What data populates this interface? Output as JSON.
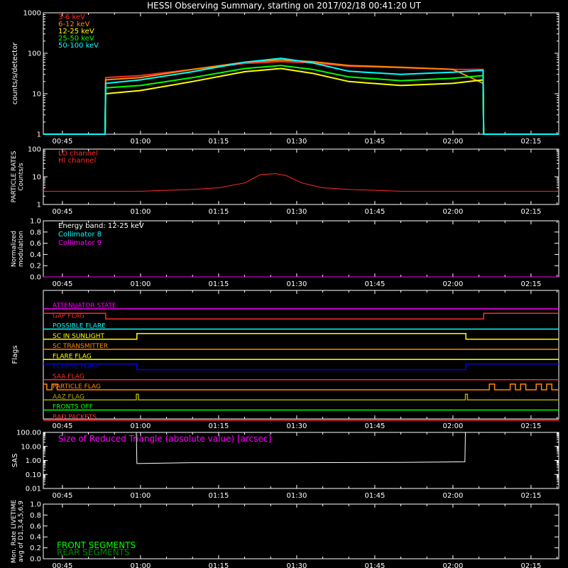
{
  "title": "HESSI Observing Summary, starting on 2017/02/18 00:41:20 UT",
  "time_ticks": [
    "00:45",
    "01:00",
    "01:15",
    "01:30",
    "01:45",
    "02:00",
    "02:15"
  ],
  "chart_data": [
    {
      "type": "line",
      "panel": "counts",
      "ylabel": "counts/s/detector",
      "yscale": "log",
      "ylim": [
        1,
        1000
      ],
      "yticks": [
        "1",
        "10",
        "100",
        "1000"
      ],
      "x_range_min": [
        41.33,
        140.33
      ],
      "series": [
        {
          "name": "3-6 keV",
          "color": "#ff2a2a",
          "points": [
            [
              41.33,
              1
            ],
            [
              53.2,
              1
            ],
            [
              53.3,
              25
            ],
            [
              60,
              28
            ],
            [
              70,
              40
            ],
            [
              80,
              56
            ],
            [
              87,
              62
            ],
            [
              93,
              58
            ],
            [
              100,
              48
            ],
            [
              110,
              44
            ],
            [
              120,
              40
            ],
            [
              125.8,
              40
            ],
            [
              125.9,
              1
            ],
            [
              140.33,
              1
            ]
          ]
        },
        {
          "name": "6-12 keV",
          "color": "#ff8800",
          "points": [
            [
              41.33,
              1
            ],
            [
              53.2,
              1
            ],
            [
              53.3,
              22
            ],
            [
              60,
              25
            ],
            [
              70,
              40
            ],
            [
              80,
              60
            ],
            [
              87,
              68
            ],
            [
              93,
              62
            ],
            [
              100,
              50
            ],
            [
              110,
              45
            ],
            [
              120,
              40
            ],
            [
              125.8,
              18
            ],
            [
              125.9,
              1
            ],
            [
              140.33,
              1
            ]
          ]
        },
        {
          "name": "12-25 keV",
          "color": "#ffff00",
          "points": [
            [
              41.33,
              1
            ],
            [
              53.2,
              1
            ],
            [
              53.3,
              10
            ],
            [
              60,
              12
            ],
            [
              70,
              20
            ],
            [
              80,
              35
            ],
            [
              87,
              42
            ],
            [
              93,
              32
            ],
            [
              100,
              20
            ],
            [
              110,
              16
            ],
            [
              120,
              18
            ],
            [
              125.8,
              22
            ],
            [
              125.9,
              1
            ],
            [
              140.33,
              1
            ]
          ]
        },
        {
          "name": "25-50 keV",
          "color": "#00ff00",
          "points": [
            [
              41.33,
              1
            ],
            [
              53.2,
              1
            ],
            [
              53.3,
              14
            ],
            [
              60,
              16
            ],
            [
              70,
              25
            ],
            [
              80,
              42
            ],
            [
              87,
              50
            ],
            [
              93,
              40
            ],
            [
              100,
              26
            ],
            [
              110,
              21
            ],
            [
              120,
              24
            ],
            [
              125.8,
              28
            ],
            [
              125.9,
              1
            ],
            [
              140.33,
              1
            ]
          ]
        },
        {
          "name": "50-100 keV",
          "color": "#00ffff",
          "points": [
            [
              41.33,
              1
            ],
            [
              53.2,
              1
            ],
            [
              53.3,
              18
            ],
            [
              60,
              22
            ],
            [
              70,
              35
            ],
            [
              80,
              60
            ],
            [
              87,
              75
            ],
            [
              93,
              58
            ],
            [
              100,
              36
            ],
            [
              110,
              30
            ],
            [
              120,
              34
            ],
            [
              125.8,
              38
            ],
            [
              125.9,
              1
            ],
            [
              140.33,
              1
            ]
          ]
        }
      ]
    },
    {
      "type": "line",
      "panel": "particles",
      "ylabel": "PARTICLE RATES",
      "ylabel2": "Counts/s",
      "yscale": "log",
      "ylim": [
        1,
        100
      ],
      "yticks": [
        "1",
        "10",
        "100"
      ],
      "series": [
        {
          "name": "LO channel",
          "color": "#ff2a2a",
          "points": []
        },
        {
          "name": "HI channel",
          "color": "#ff2a2a",
          "points": [
            [
              41.33,
              3
            ],
            [
              60,
              3
            ],
            [
              70,
              3.5
            ],
            [
              75,
              4
            ],
            [
              80,
              6
            ],
            [
              83,
              12
            ],
            [
              86,
              13
            ],
            [
              88,
              11
            ],
            [
              91,
              6
            ],
            [
              95,
              4
            ],
            [
              100,
              3.5
            ],
            [
              110,
              3
            ],
            [
              120,
              3
            ],
            [
              130,
              3
            ],
            [
              140.33,
              3
            ]
          ]
        }
      ]
    },
    {
      "type": "line",
      "panel": "modulation",
      "ylabel": "Normalized",
      "ylabel2": "modulation",
      "ylim": [
        0,
        1
      ],
      "yticks": [
        "0.0",
        "0.2",
        "0.4",
        "0.6",
        "0.8",
        "1.0"
      ],
      "note": "Energy band: 12-25 keV",
      "series": [
        {
          "name": "Collimator 8",
          "color": "#00ffff",
          "points": [
            [
              41.33,
              0
            ],
            [
              140.33,
              0
            ]
          ]
        },
        {
          "name": "Collimator 9",
          "color": "#ff00ff",
          "points": [
            [
              41.33,
              0
            ],
            [
              140.33,
              0
            ]
          ]
        }
      ]
    },
    {
      "type": "line",
      "panel": "flags",
      "ylabel": "Flags",
      "series": [
        {
          "name": "ATTENUATOR STATE",
          "color": "#ff00ff",
          "steps": [
            [
              41.33,
              0
            ],
            [
              140.33,
              0
            ]
          ]
        },
        {
          "name": "GAP FLAG",
          "color": "#ff2a2a",
          "steps": [
            [
              41.33,
              1
            ],
            [
              53.3,
              0
            ],
            [
              125.9,
              1
            ]
          ]
        },
        {
          "name": "POSSIBLE FLARE",
          "color": "#00ffff",
          "steps": [
            [
              41.33,
              0
            ]
          ]
        },
        {
          "name": "SC IN SUNLIGHT",
          "color": "#ffff00",
          "steps": [
            [
              41.33,
              0
            ],
            [
              59.3,
              1
            ],
            [
              122.5,
              0
            ]
          ]
        },
        {
          "name": "SC TRANSMITTER",
          "color": "#ff8800",
          "steps": [
            [
              41.33,
              0
            ]
          ]
        },
        {
          "name": "FLARE FLAG",
          "color": "#ffff00",
          "steps": [
            [
              41.33,
              0
            ]
          ]
        },
        {
          "name": "ECLIPSE FLAG",
          "color": "#0000ff",
          "steps": [
            [
              41.33,
              1
            ],
            [
              59.3,
              0
            ],
            [
              122.5,
              1
            ]
          ]
        },
        {
          "name": "SAA FLAG",
          "color": "#ff2a2a",
          "steps": [
            [
              41.33,
              0
            ]
          ]
        },
        {
          "name": "PARTICLE FLAG",
          "color": "#ff8800",
          "steps": [
            [
              41.33,
              1
            ],
            [
              42,
              0
            ],
            [
              43,
              1
            ],
            [
              44,
              0
            ],
            [
              127,
              1
            ],
            [
              128,
              0
            ],
            [
              131,
              1
            ],
            [
              132,
              0
            ],
            [
              133,
              1
            ],
            [
              134,
              0
            ],
            [
              136,
              1
            ],
            [
              137,
              0
            ],
            [
              138,
              1
            ],
            [
              139,
              0
            ]
          ]
        },
        {
          "name": "AAZ FLAG",
          "color": "#aaaa00",
          "steps": [
            [
              41.33,
              0
            ],
            [
              59.2,
              1
            ],
            [
              59.6,
              0
            ],
            [
              122.4,
              1
            ],
            [
              122.8,
              0
            ]
          ]
        },
        {
          "name": "FRONTS OFF",
          "color": "#00ff00",
          "steps": [
            [
              41.33,
              0
            ]
          ]
        },
        {
          "name": "BAD PACKETS",
          "color": "#ff2a2a",
          "steps": [
            [
              41.33,
              0
            ]
          ]
        }
      ]
    },
    {
      "type": "line",
      "panel": "sas",
      "ylabel": "SAS",
      "yscale": "log",
      "ylim": [
        0.01,
        100
      ],
      "yticks": [
        "0.01",
        "0.10",
        "1.00",
        "10.00",
        "100.00"
      ],
      "note": "Size of Reduced Triangle (absolute value) [arcsec]",
      "series": [
        {
          "name": "SAS",
          "color": "#ffffff",
          "points": [
            [
              59.2,
              100
            ],
            [
              59.3,
              0.6
            ],
            [
              70,
              0.7
            ],
            [
              90,
              0.7
            ],
            [
              110,
              0.72
            ],
            [
              122.3,
              0.8
            ],
            [
              122.4,
              100
            ]
          ]
        }
      ]
    },
    {
      "type": "line",
      "panel": "livetime",
      "ylabel": "Mon. Rate LIVETIME",
      "ylabel2": "avg of D1,3,4,5,6,9",
      "ylim": [
        0,
        1
      ],
      "yticks": [
        "0.0",
        "0.2",
        "0.4",
        "0.6",
        "0.8",
        "1.0"
      ],
      "series": [
        {
          "name": "FRONT SEGMENTS",
          "color": "#00ff00",
          "points": []
        },
        {
          "name": "REAR SEGMENTS",
          "color": "#008800",
          "points": []
        }
      ]
    }
  ]
}
